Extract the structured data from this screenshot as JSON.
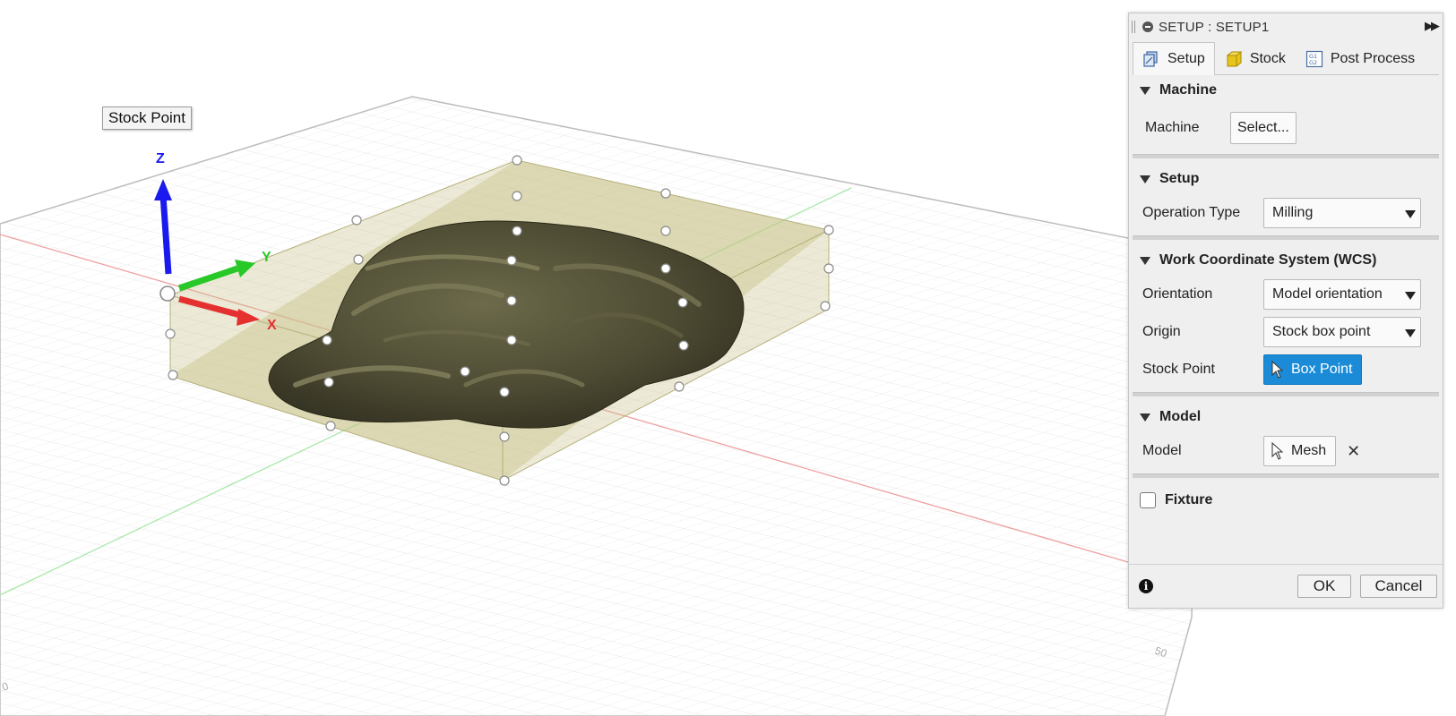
{
  "viewport": {
    "tooltip": "Stock Point",
    "axes": {
      "x": "X",
      "y": "Y",
      "z": "Z"
    },
    "grid_labels": [
      "50",
      "0"
    ]
  },
  "panel": {
    "title": "SETUP : SETUP1",
    "tabs": [
      {
        "label": "Setup",
        "icon": "setup-icon",
        "active": true
      },
      {
        "label": "Stock",
        "icon": "stock-cube-icon",
        "active": false
      },
      {
        "label": "Post Process",
        "icon": "gcode-icon",
        "active": false
      }
    ],
    "machine": {
      "header": "Machine",
      "label": "Machine",
      "button": "Select..."
    },
    "setup": {
      "header": "Setup",
      "operation_type_label": "Operation Type",
      "operation_type_value": "Milling"
    },
    "wcs": {
      "header": "Work Coordinate System (WCS)",
      "orientation_label": "Orientation",
      "orientation_value": "Model orientation",
      "origin_label": "Origin",
      "origin_value": "Stock box point",
      "stock_point_label": "Stock Point",
      "stock_point_value": "Box Point"
    },
    "model": {
      "header": "Model",
      "label": "Model",
      "value": "Mesh"
    },
    "fixture": {
      "label": "Fixture",
      "checked": false
    },
    "footer": {
      "ok": "OK",
      "cancel": "Cancel"
    }
  },
  "colors": {
    "accent_blue": "#1b8bd8",
    "axis_x": "#e53030",
    "axis_y": "#28c828",
    "axis_z": "#1a1aee",
    "stock_box": "#c9c48a",
    "mesh": "#4e4b33"
  }
}
